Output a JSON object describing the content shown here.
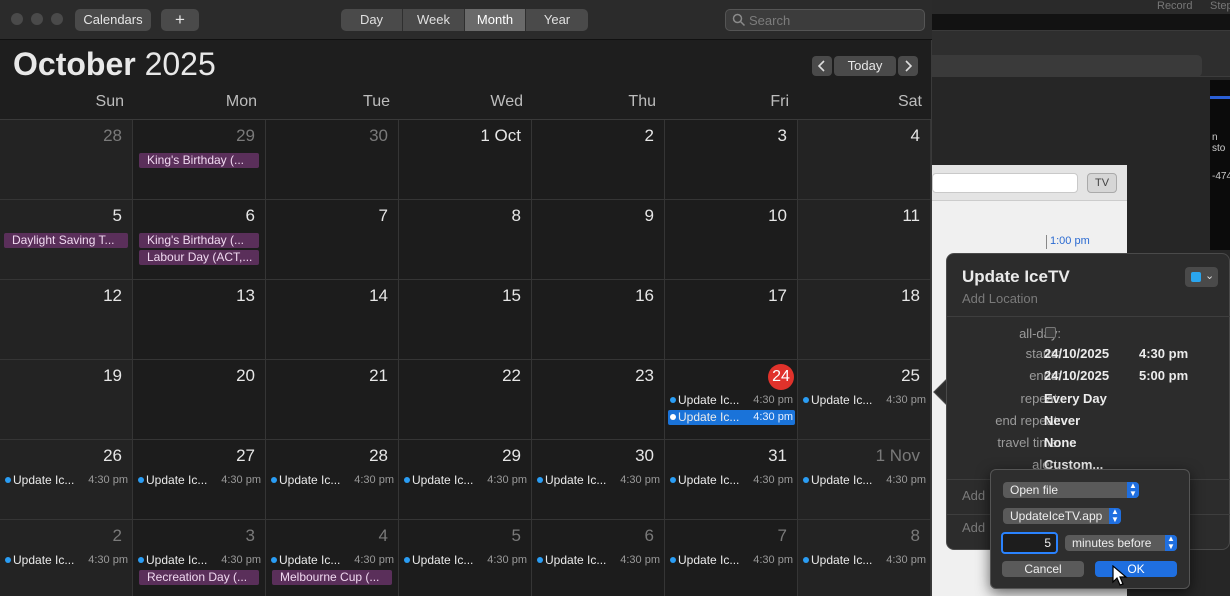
{
  "background": {
    "menu_items": [
      "Record",
      "Step"
    ],
    "side_labels": [
      "n sto",
      "-474"
    ],
    "tv_button": "TV",
    "time_label": "1:00 pm"
  },
  "toolbar": {
    "calendars_label": "Calendars",
    "add_label": "+",
    "views": [
      "Day",
      "Week",
      "Month",
      "Year"
    ],
    "active_view": "Month",
    "search_placeholder": "Search"
  },
  "header": {
    "month": "October",
    "year": "2025",
    "today_label": "Today",
    "prev_icon": "chevron-left-icon",
    "next_icon": "chevron-right-icon"
  },
  "weekdays": [
    "Sun",
    "Mon",
    "Tue",
    "Wed",
    "Thu",
    "Fri",
    "Sat"
  ],
  "weeks": [
    [
      {
        "day": "28",
        "dim": true,
        "events": []
      },
      {
        "day": "29",
        "dim": true,
        "events": [
          {
            "kind": "bar",
            "title": "King's Birthday (..."
          }
        ]
      },
      {
        "day": "30",
        "dim": true,
        "events": []
      },
      {
        "day": "1 Oct",
        "events": []
      },
      {
        "day": "2",
        "events": []
      },
      {
        "day": "3",
        "events": []
      },
      {
        "day": "4",
        "events": []
      }
    ],
    [
      {
        "day": "5",
        "events": [
          {
            "kind": "bar",
            "title": "Daylight Saving T..."
          }
        ]
      },
      {
        "day": "6",
        "events": [
          {
            "kind": "bar",
            "title": "King's Birthday (..."
          },
          {
            "kind": "bar",
            "title": "Labour Day (ACT,..."
          }
        ]
      },
      {
        "day": "7",
        "events": []
      },
      {
        "day": "8",
        "events": []
      },
      {
        "day": "9",
        "events": []
      },
      {
        "day": "10",
        "events": []
      },
      {
        "day": "11",
        "events": []
      }
    ],
    [
      {
        "day": "12",
        "events": []
      },
      {
        "day": "13",
        "events": []
      },
      {
        "day": "14",
        "events": []
      },
      {
        "day": "15",
        "events": []
      },
      {
        "day": "16",
        "events": []
      },
      {
        "day": "17",
        "events": []
      },
      {
        "day": "18",
        "events": []
      }
    ],
    [
      {
        "day": "19",
        "events": []
      },
      {
        "day": "20",
        "events": []
      },
      {
        "day": "21",
        "events": []
      },
      {
        "day": "22",
        "events": []
      },
      {
        "day": "23",
        "events": []
      },
      {
        "day": "24",
        "today": true,
        "events": [
          {
            "kind": "timed",
            "title": "Update Ic...",
            "time": "4:30 pm"
          },
          {
            "kind": "timed",
            "title": "Update Ic...",
            "time": "4:30 pm",
            "selected": true
          }
        ]
      },
      {
        "day": "25",
        "events": [
          {
            "kind": "timed",
            "title": "Update Ic...",
            "time": "4:30 pm"
          }
        ]
      }
    ],
    [
      {
        "day": "26",
        "events": [
          {
            "kind": "timed",
            "title": "Update Ic...",
            "time": "4:30 pm"
          }
        ]
      },
      {
        "day": "27",
        "events": [
          {
            "kind": "timed",
            "title": "Update Ic...",
            "time": "4:30 pm"
          }
        ]
      },
      {
        "day": "28",
        "events": [
          {
            "kind": "timed",
            "title": "Update Ic...",
            "time": "4:30 pm"
          }
        ]
      },
      {
        "day": "29",
        "events": [
          {
            "kind": "timed",
            "title": "Update Ic...",
            "time": "4:30 pm"
          }
        ]
      },
      {
        "day": "30",
        "events": [
          {
            "kind": "timed",
            "title": "Update Ic...",
            "time": "4:30 pm"
          }
        ]
      },
      {
        "day": "31",
        "events": [
          {
            "kind": "timed",
            "title": "Update Ic...",
            "time": "4:30 pm"
          }
        ]
      },
      {
        "day": "1 Nov",
        "dim": true,
        "events": [
          {
            "kind": "timed",
            "title": "Update Ic...",
            "time": "4:30 pm"
          }
        ]
      }
    ],
    [
      {
        "day": "2",
        "dim": true,
        "events": [
          {
            "kind": "timed",
            "title": "Update Ic...",
            "time": "4:30 pm"
          }
        ]
      },
      {
        "day": "3",
        "dim": true,
        "events": [
          {
            "kind": "timed",
            "title": "Update Ic...",
            "time": "4:30 pm"
          },
          {
            "kind": "bar",
            "title": "Recreation Day (..."
          }
        ]
      },
      {
        "day": "4",
        "dim": true,
        "events": [
          {
            "kind": "timed",
            "title": "Update Ic...",
            "time": "4:30 pm"
          },
          {
            "kind": "bar",
            "title": "Melbourne Cup (..."
          }
        ]
      },
      {
        "day": "5",
        "dim": true,
        "events": [
          {
            "kind": "timed",
            "title": "Update Ic...",
            "time": "4:30 pm"
          }
        ]
      },
      {
        "day": "6",
        "dim": true,
        "events": [
          {
            "kind": "timed",
            "title": "Update Ic...",
            "time": "4:30 pm"
          }
        ]
      },
      {
        "day": "7",
        "dim": true,
        "events": [
          {
            "kind": "timed",
            "title": "Update Ic...",
            "time": "4:30 pm"
          }
        ]
      },
      {
        "day": "8",
        "dim": true,
        "events": [
          {
            "kind": "timed",
            "title": "Update Ic...",
            "time": "4:30 pm"
          }
        ]
      }
    ]
  ],
  "popover": {
    "title": "Update IceTV",
    "location_placeholder": "Add Location",
    "calendar_color": "#2aa6ef",
    "fields": {
      "allday_label": "all-day:",
      "starts_label": "starts:",
      "starts_date": "24/10/2025",
      "starts_time": "4:30 pm",
      "ends_label": "ends:",
      "ends_date": "24/10/2025",
      "ends_time": "5:00 pm",
      "repeat_label": "repeat:",
      "repeat_value": "Every Day",
      "end_repeat_label": "end repeat:",
      "end_repeat_value": "Never",
      "travel_label": "travel time:",
      "travel_value": "None",
      "alert_label": "alert:",
      "alert_value": "Custom..."
    },
    "add_rows": [
      "Add",
      "Add"
    ]
  },
  "alert_sheet": {
    "action": "Open file",
    "file": "UpdateIceTV.app",
    "amount": "5",
    "unit": "minutes before",
    "cancel_label": "Cancel",
    "ok_label": "OK"
  }
}
